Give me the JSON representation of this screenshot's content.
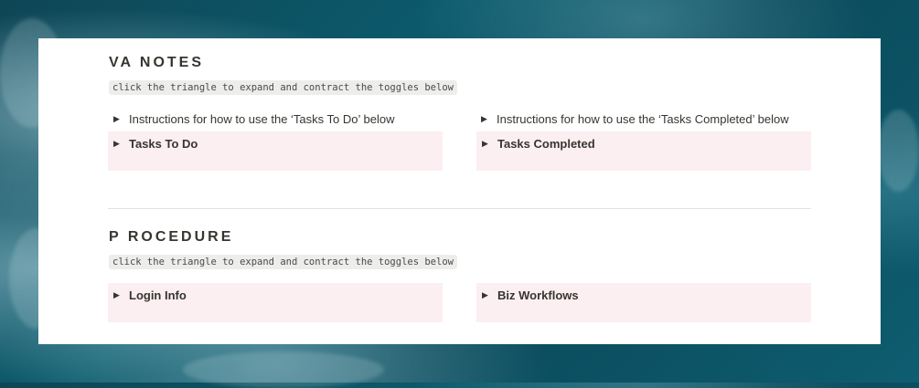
{
  "va_notes": {
    "title": "VA NOTES",
    "hint": "click the triangle to expand and contract the toggles below",
    "left_instruction": "Instructions for how to use the ‘Tasks To Do’ below",
    "right_instruction": "Instructions for how to use the ‘Tasks Completed’ below",
    "left_block": "Tasks To Do",
    "right_block": "Tasks Completed"
  },
  "procedure": {
    "title": "P ROCEDURE",
    "hint": "click the triangle to expand and contract the toggles below",
    "left_block": "Login Info",
    "right_block": "Biz Workflows"
  },
  "icons": {
    "toggle": "triangle-right-icon",
    "toggle_glyph": "▶"
  },
  "colors": {
    "card": "#ffffff",
    "callout": "#fbeff2",
    "text": "#37352f"
  }
}
